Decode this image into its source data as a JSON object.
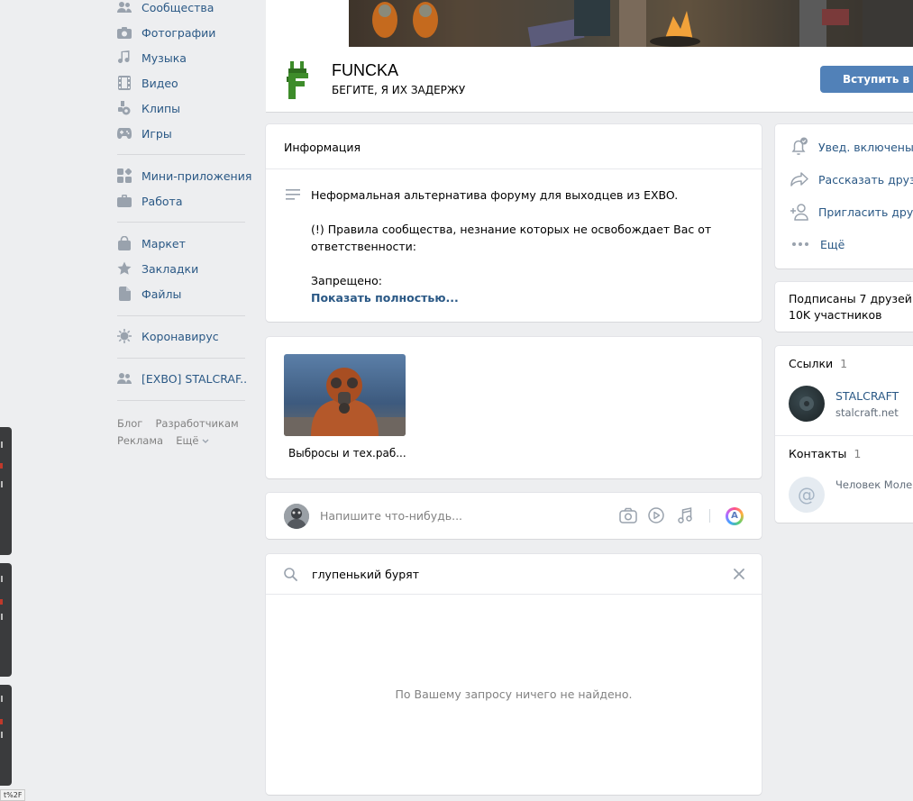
{
  "sidebar": {
    "items": [
      {
        "label": "Сообщества",
        "icon": "groups-icon"
      },
      {
        "label": "Фотографии",
        "icon": "camera-icon"
      },
      {
        "label": "Музыка",
        "icon": "music-note-icon"
      },
      {
        "label": "Видео",
        "icon": "film-icon"
      },
      {
        "label": "Клипы",
        "icon": "clips-icon"
      },
      {
        "label": "Игры",
        "icon": "gamepad-icon"
      },
      {
        "label": "Мини-приложения",
        "icon": "apps-icon"
      },
      {
        "label": "Работа",
        "icon": "briefcase-icon"
      },
      {
        "label": "Маркет",
        "icon": "shopping-bag-icon"
      },
      {
        "label": "Закладки",
        "icon": "star-icon"
      },
      {
        "label": "Файлы",
        "icon": "file-icon"
      },
      {
        "label": "Коронавирус",
        "icon": "virus-icon"
      },
      {
        "label": "[EXBO] STALCRAF..",
        "icon": "group-users-icon"
      }
    ],
    "footer": [
      "Блог",
      "Разработчикам",
      "Реклама",
      "Ещё"
    ]
  },
  "group": {
    "name": "FUNCKA",
    "status": "БЕГИТЕ, Я ИХ ЗАДЕРЖУ",
    "join_label": "Вступить в гр"
  },
  "info": {
    "title": "Информация",
    "line1": "Неформальная альтернатива форуму для выходцев из EXBO.",
    "line2a": "(!) Правила сообщества, незнание которых не освобождает Вас от",
    "line2b": "ответственности:",
    "line3": "Запрещено:",
    "more": "Показать полностью..."
  },
  "album": {
    "caption": "Выбросы и тех.раб..."
  },
  "composer": {
    "placeholder": "Напишите что-нибудь..."
  },
  "search": {
    "value": "глупенький бурят",
    "empty": "По Вашему запросу ничего не найдено."
  },
  "actions": [
    {
      "label": "Увед. включены",
      "icon": "bell-check-icon"
    },
    {
      "label": "Рассказать друзь",
      "icon": "share-arrow-icon"
    },
    {
      "label": "Пригласить друзе",
      "icon": "add-person-icon"
    },
    {
      "label": "Ещё",
      "icon": "more-dots-icon"
    }
  ],
  "followers": {
    "friends": "Подписаны 7 друзей",
    "members": "10K участников"
  },
  "links": {
    "title": "Ссылки",
    "count": "1",
    "name": "STALCRAFT",
    "url": "stalcraft.net"
  },
  "contacts": {
    "title": "Контакты",
    "count": "1",
    "name": "Человек Молек"
  },
  "status_bar": "t%2F",
  "colors": {
    "accent": "#2a5885",
    "button": "#5181b8",
    "background": "#edeef0",
    "logo_green": "#3d8c2a"
  }
}
